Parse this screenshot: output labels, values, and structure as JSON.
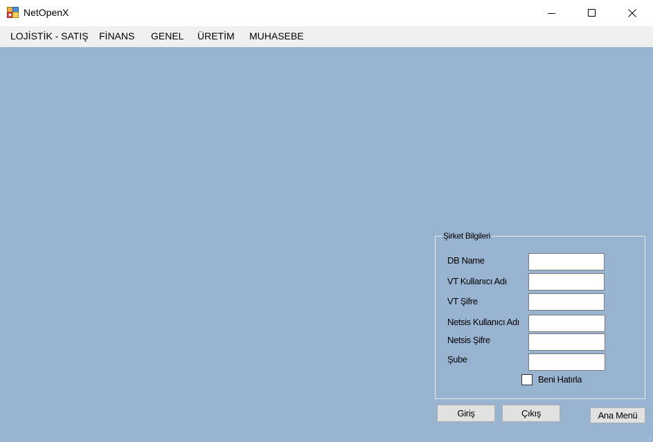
{
  "window": {
    "title": "NetOpenX",
    "icon": "app-window-icon",
    "controls": [
      "minimize-icon",
      "maximize-icon",
      "close-icon"
    ]
  },
  "menu": {
    "items": [
      {
        "label": "LOJİSTİK - SATIŞ"
      },
      {
        "label": "FİNANS"
      },
      {
        "label": "GENEL"
      },
      {
        "label": "ÜRETİM"
      },
      {
        "label": "MUHASEBE"
      }
    ]
  },
  "colors": {
    "client_background": "#99b4d1",
    "menu_background": "#f0f0f0",
    "button_face": "#e1e1e1"
  },
  "company_group": {
    "title": "Şirket Bilgileri",
    "fields": [
      {
        "label": "DB Name",
        "value": ""
      },
      {
        "label": "VT Kullanıcı Adı",
        "value": ""
      },
      {
        "label": "VT Şifre",
        "value": ""
      },
      {
        "label": "Netsis Kullanıcı Adı",
        "value": ""
      },
      {
        "label": "Netsis Şifre",
        "value": ""
      },
      {
        "label": "Şube",
        "value": ""
      }
    ],
    "remember_me": {
      "label": "Beni Hatırla",
      "checked": false
    }
  },
  "buttons": {
    "login": "Giriş",
    "exit": "Çıkış",
    "main_menu": "Ana Menü"
  }
}
